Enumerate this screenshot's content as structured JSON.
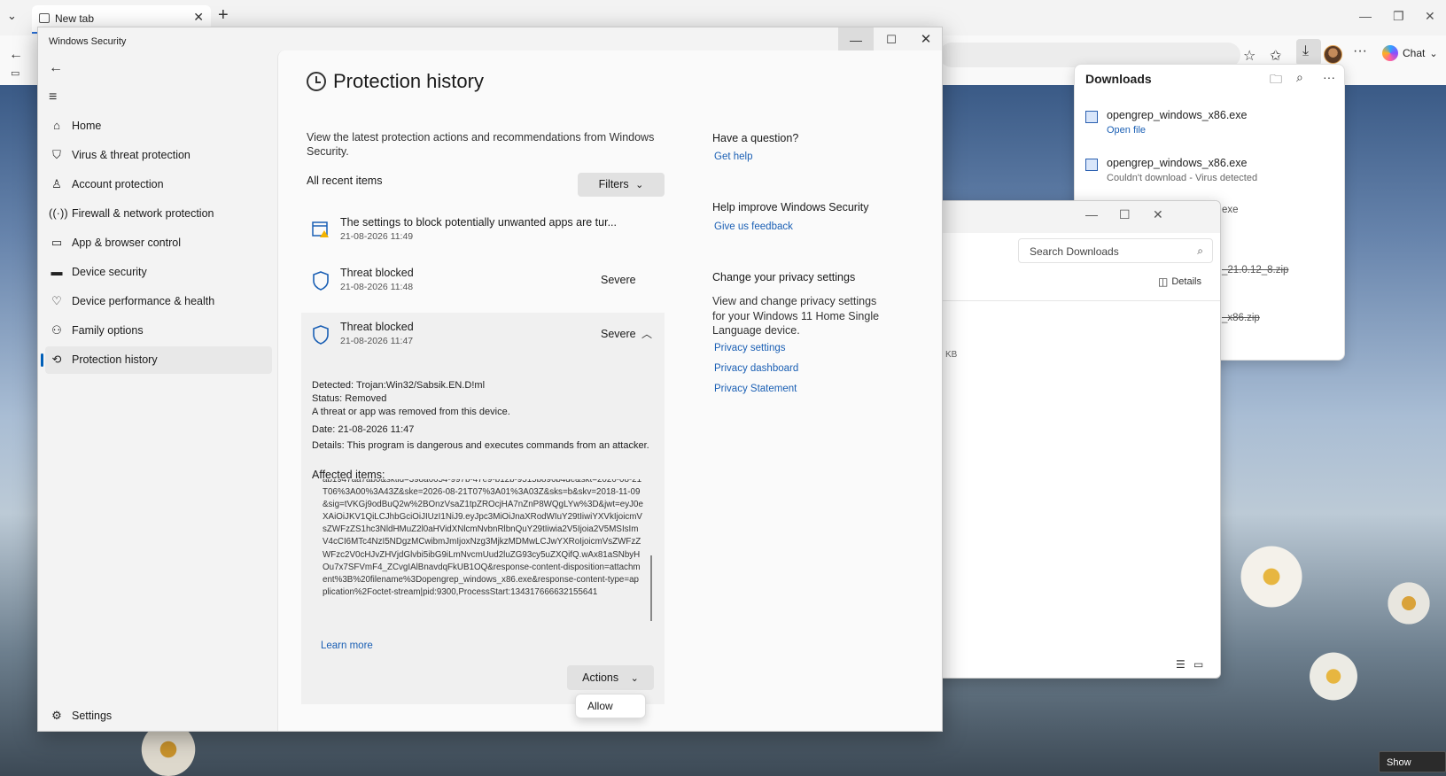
{
  "browser": {
    "tab_title": "New tab",
    "chat_label": "Chat"
  },
  "downloads_panel": {
    "title": "Downloads",
    "items": [
      {
        "name": "opengrep_windows_x86.exe",
        "sub": "Open file"
      },
      {
        "name": "opengrep_windows_x86.exe",
        "sub": "Couldn't download - Virus detected"
      }
    ],
    "fragments": [
      "exe",
      "_21.0.12_8.zip",
      "_x86.zip"
    ]
  },
  "explorer": {
    "search_placeholder": "Search Downloads",
    "details_label": "Details",
    "size_fragment": "KB"
  },
  "window": {
    "title": "Windows Security"
  },
  "nav": {
    "items": [
      {
        "label": "Home",
        "icon": "home-icon"
      },
      {
        "label": "Virus & threat protection",
        "icon": "shield-icon"
      },
      {
        "label": "Account protection",
        "icon": "person-icon"
      },
      {
        "label": "Firewall & network protection",
        "icon": "wifi-icon"
      },
      {
        "label": "App & browser control",
        "icon": "app-window-icon"
      },
      {
        "label": "Device security",
        "icon": "laptop-icon"
      },
      {
        "label": "Device performance & health",
        "icon": "heart-icon"
      },
      {
        "label": "Family options",
        "icon": "family-icon"
      },
      {
        "label": "Protection history",
        "icon": "history-icon"
      }
    ],
    "settings_label": "Settings"
  },
  "page": {
    "title": "Protection history",
    "description": "View the latest protection actions and recommendations from Windows Security.",
    "list_label": "All recent items",
    "filters_label": "Filters",
    "items": [
      {
        "title": "The settings to block potentially unwanted apps are tur...",
        "date": "21-08-2026 11:49",
        "severity": ""
      },
      {
        "title": "Threat blocked",
        "date": "21-08-2026 11:48",
        "severity": "Severe"
      },
      {
        "title": "Threat blocked",
        "date": "21-08-2026 11:47",
        "severity": "Severe"
      }
    ],
    "details": {
      "detected": "Detected:  Trojan:Win32/Sabsik.EN.D!ml",
      "status": "Status:  Removed",
      "status_note": "A threat or app was removed from this device.",
      "date": "Date:  21-08-2026 11:47",
      "details": "Details:  This program is dangerous and executes commands from an attacker.",
      "affected_label": "Affected items:",
      "affected_text": "ab1947aa7ab0&sktid=398a6654-997b-47e9-b12b-9515b896b4de&skt=2026-08-21T06%3A00%3A43Z&ske=2026-08-21T07%3A01%3A03Z&sks=b&skv=2018-11-09&sig=tVKGj9odBuQ2w%2BOnzVsaZ1tpZROcjHA7nZnP8WQgLYw%3D&jwt=eyJ0eXAiOiJKV1QiLCJhbGciOiJIUzI1NiJ9.eyJpc3MiOiJnaXRodWIuY29tIiwiYXVkIjoicmVsZWFzZS1hc3NldHMuZ2l0aHVidXNlcmNvbnRlbnQuY29tIiwia2V5Ijoia2V5MSIsImV4cCI6MTc4NzI5NDgzMCwibmJmIjoxNzg3MjkzMDMwLCJwYXRoIjoicmVsZWFzZWFzc2V0cHJvZHVjdGlvbi5ibG9iLmNvcmUud2luZG93cy5uZXQifQ.wAx81aSNbyHOu7x7SFVmF4_ZCvgIAlBnavdqFkUB1OQ&response-content-disposition=attachment%3B%20filename%3Dopengrep_windows_x86.exe&response-content-type=application%2Foctet-stream|pid:9300,ProcessStart:134317666632155641",
      "learn_more": "Learn more",
      "actions_label": "Actions",
      "allow_label": "Allow"
    }
  },
  "side": {
    "question_heading": "Have a question?",
    "get_help": "Get help",
    "improve_heading": "Help improve Windows Security",
    "feedback": "Give us feedback",
    "privacy_heading": "Change your privacy settings",
    "privacy_text": "View and change privacy settings for your Windows 11 Home Single Language device.",
    "privacy_settings": "Privacy settings",
    "privacy_dashboard": "Privacy dashboard",
    "privacy_statement": "Privacy Statement"
  },
  "desktop": {
    "show_desktop": "Show desktop"
  },
  "colors": {
    "accent": "#005fb8",
    "link": "#1a5fb4",
    "severe_shield": "#1a5fb4",
    "warning": "#f2b200"
  }
}
